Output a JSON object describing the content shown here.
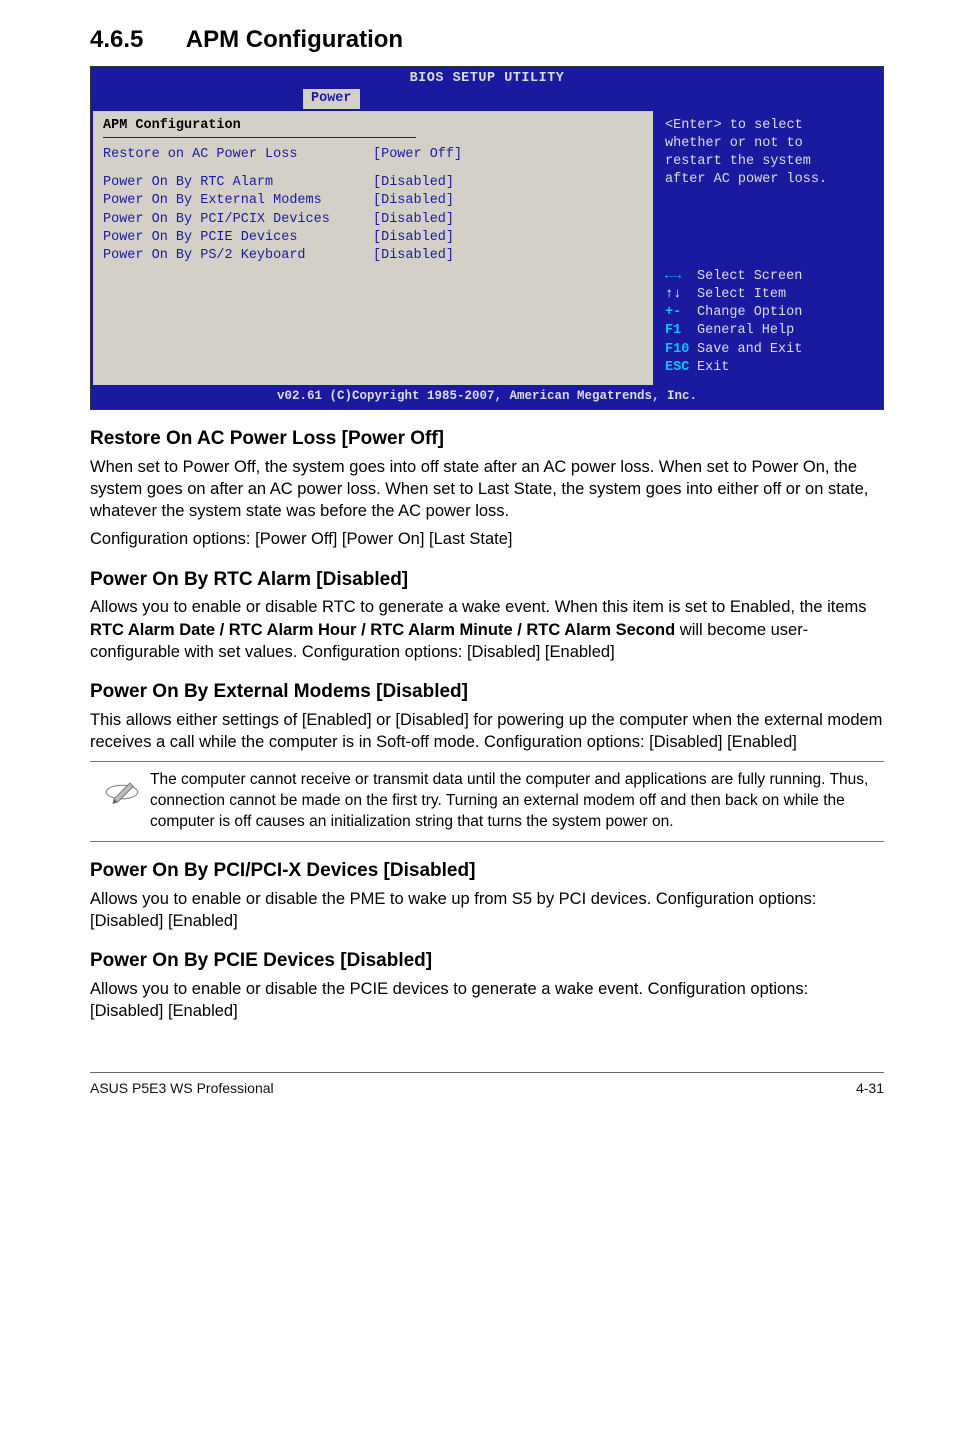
{
  "section": {
    "num": "4.6.5",
    "title": "APM Configuration"
  },
  "bios": {
    "title": "BIOS SETUP UTILITY",
    "tab": "Power",
    "panel_heading": "APM Configuration",
    "rows": [
      {
        "label": "Restore on AC Power Loss",
        "value": "[Power Off]"
      },
      {
        "label": "Power On By RTC Alarm",
        "value": "[Disabled]"
      },
      {
        "label": "Power On By External Modems",
        "value": "[Disabled]"
      },
      {
        "label": "Power On By PCI/PCIX Devices",
        "value": "[Disabled]"
      },
      {
        "label": "Power On By PCIE Devices",
        "value": "[Disabled]"
      },
      {
        "label": "Power On By PS/2 Keyboard",
        "value": "[Disabled]"
      }
    ],
    "help": {
      "l1": "<Enter> to select",
      "l2": "whether or not to",
      "l3": "restart the system",
      "l4": "after AC power loss."
    },
    "nav": [
      {
        "glyph": "←→",
        "cls": "",
        "text": "Select Screen"
      },
      {
        "glyph": "↑↓",
        "cls": "white",
        "text": "Select Item"
      },
      {
        "glyph": "+-",
        "cls": "",
        "text": "Change Option"
      },
      {
        "glyph": "F1",
        "cls": "",
        "text": "General Help"
      },
      {
        "glyph": "F10",
        "cls": "",
        "text": "Save and Exit"
      },
      {
        "glyph": "ESC",
        "cls": "",
        "text": "Exit"
      }
    ],
    "footer": "v02.61 (C)Copyright 1985-2007, American Megatrends, Inc."
  },
  "headings": {
    "restore": "Restore On AC Power Loss [Power Off]",
    "rtc": "Power On By RTC Alarm [Disabled]",
    "modem": "Power On By External Modems [Disabled]",
    "pci": "Power On By PCI/PCI-X Devices [Disabled]",
    "pcie": "Power On By PCIE Devices [Disabled]"
  },
  "body": {
    "restore_p1": "When set to Power Off, the system goes into off state after an AC power loss. When set to Power On, the system goes on after an AC power loss. When set to Last State, the system goes into either off or on state, whatever the system state was before the AC power loss.",
    "restore_p2": "Configuration options: [Power Off] [Power On] [Last State]",
    "rtc_p1a": "Allows you to enable or disable RTC to generate a wake event. When this item is set to Enabled, the items ",
    "rtc_bold": "RTC Alarm Date / RTC Alarm Hour / RTC Alarm Minute / RTC Alarm Second",
    "rtc_p1b": " will become user-configurable with set values. Configuration options: [Disabled] [Enabled]",
    "modem_p1": "This allows either settings of [Enabled] or [Disabled] for powering up the computer when the external modem receives a call while the computer is in Soft-off mode. Configuration options: [Disabled] [Enabled]",
    "note": "The computer cannot receive or transmit data until the computer and applications are fully running. Thus, connection cannot be made on the first try. Turning an external modem off and then back on while the computer is off causes an initialization string that turns the system power on.",
    "pci_p1": "Allows you to enable or disable the PME to wake up from S5 by PCI devices. Configuration options: [Disabled] [Enabled]",
    "pcie_p1": "Allows you to enable or disable the PCIE devices to generate a wake event. Configuration options: [Disabled] [Enabled]"
  },
  "footer": {
    "left": "ASUS P5E3 WS Professional",
    "right": "4-31"
  }
}
